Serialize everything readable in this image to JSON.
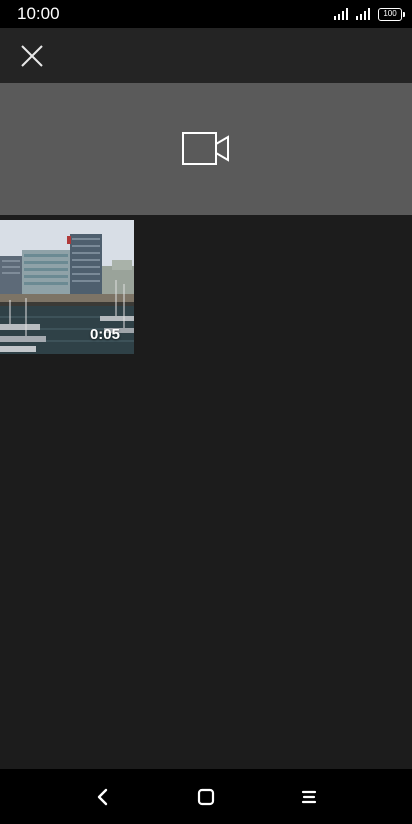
{
  "status_bar": {
    "time": "10:00",
    "battery_level": "100",
    "icons": [
      "signal-icon",
      "signal-icon",
      "battery-icon"
    ]
  },
  "app_bar": {
    "close_icon": "close-icon"
  },
  "camera_banner": {
    "icon": "video-camera-icon"
  },
  "media": {
    "items": [
      {
        "type": "video",
        "duration": "0:05"
      }
    ]
  },
  "nav_bar": {
    "icons": [
      "back-icon",
      "home-icon",
      "menu-icon"
    ]
  },
  "colors": {
    "background": "#1c1c1c",
    "app_bar": "#242424",
    "banner": "#5a5a5a",
    "status_bar": "#000000"
  }
}
